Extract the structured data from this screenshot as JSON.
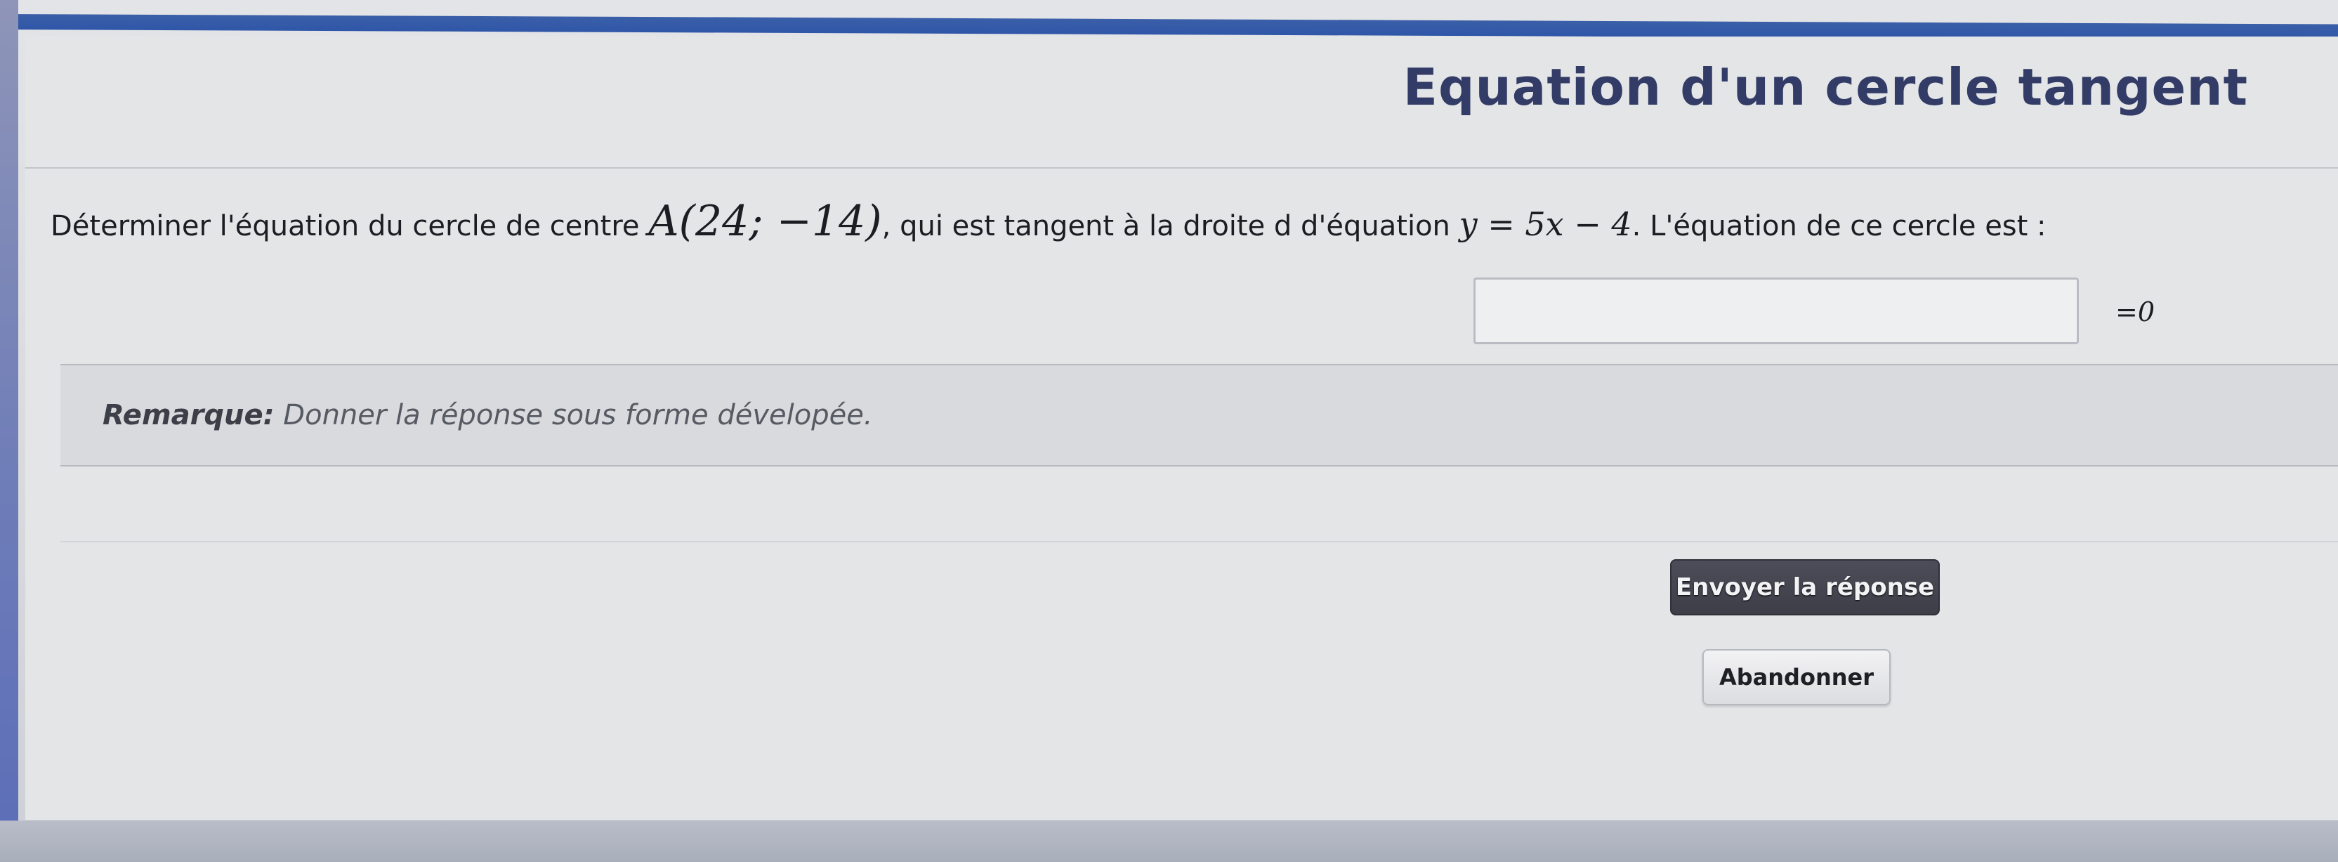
{
  "title": "Equation d'un cercle tangent",
  "question": {
    "text_1": "Déterminer l'équation du cercle de centre ",
    "point": "A(24; −14)",
    "text_2": ", qui est tangent à la droite d d'équation ",
    "line_equation": "y = 5x − 4",
    "text_3": ". L'équation de ce cercle est :"
  },
  "answer": {
    "value": "",
    "placeholder": "",
    "suffix": "=0"
  },
  "remark": {
    "label": "Remarque:",
    "text": " Donner la réponse sous forme dévelopée."
  },
  "buttons": {
    "send": "Envoyer la réponse",
    "abandon": "Abandonner"
  }
}
